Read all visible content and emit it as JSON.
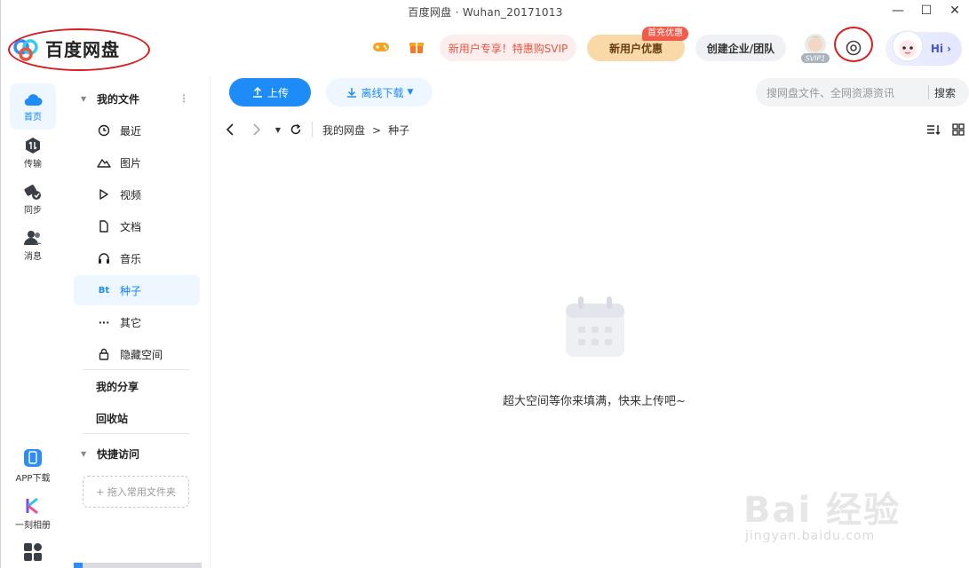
{
  "window": {
    "title": "百度网盘 · Wuhan_20171013",
    "controls": [
      "minimize-icon",
      "maximize-icon",
      "close-icon"
    ]
  },
  "header": {
    "logo_text": "百度网盘",
    "svip_promo": "新用户专享！特惠购SVIP",
    "newuser_offer": "新用户优惠",
    "newuser_badge": "首充优惠",
    "team_button": "创建企业/团队",
    "svip_tag": "SVIP1",
    "hi_label": "Hi",
    "accent_color": "#1e8cf7",
    "annotation_color": "#d81e1e"
  },
  "rail": {
    "items": [
      {
        "label": "首页",
        "icon": "cloud-icon",
        "active": true
      },
      {
        "label": "传输",
        "icon": "transfer-icon",
        "active": false
      },
      {
        "label": "同步",
        "icon": "sync-icon",
        "active": false
      },
      {
        "label": "消息",
        "icon": "contacts-icon",
        "active": false
      }
    ],
    "bottom": [
      {
        "label": "APP下载",
        "icon": "phone-icon"
      },
      {
        "label": "一刻相册",
        "icon": "album-icon"
      },
      {
        "label": "",
        "icon": "apps-grid-icon"
      }
    ]
  },
  "sidebar": {
    "my_files": "我的文件",
    "items": [
      {
        "label": "最近",
        "icon": "clock-icon"
      },
      {
        "label": "图片",
        "icon": "mountain-icon"
      },
      {
        "label": "视频",
        "icon": "play-icon"
      },
      {
        "label": "文档",
        "icon": "document-icon"
      },
      {
        "label": "音乐",
        "icon": "headphones-icon"
      },
      {
        "label": "种子",
        "icon": "bt-icon",
        "icon_text": "Bt",
        "active": true
      },
      {
        "label": "其它",
        "icon": "more-icon",
        "icon_text": "···"
      },
      {
        "label": "隐藏空间",
        "icon": "lock-icon"
      }
    ],
    "my_share": "我的分享",
    "recycle": "回收站",
    "quick_access": "快捷访问",
    "dropzone": "+ 拖入常用文件夹"
  },
  "toolbar": {
    "upload": "上传",
    "offline": "离线下载",
    "search_placeholder": "搜网盘文件、全网资源资讯",
    "search_button": "搜索"
  },
  "breadcrumb": {
    "root": "我的网盘",
    "sep": ">",
    "current": "种子"
  },
  "empty_state": {
    "message": "超大空间等你来填满，快来上传吧~"
  },
  "watermark": {
    "brand": "Bai 经验",
    "url": "jingyan.baidu.com"
  }
}
